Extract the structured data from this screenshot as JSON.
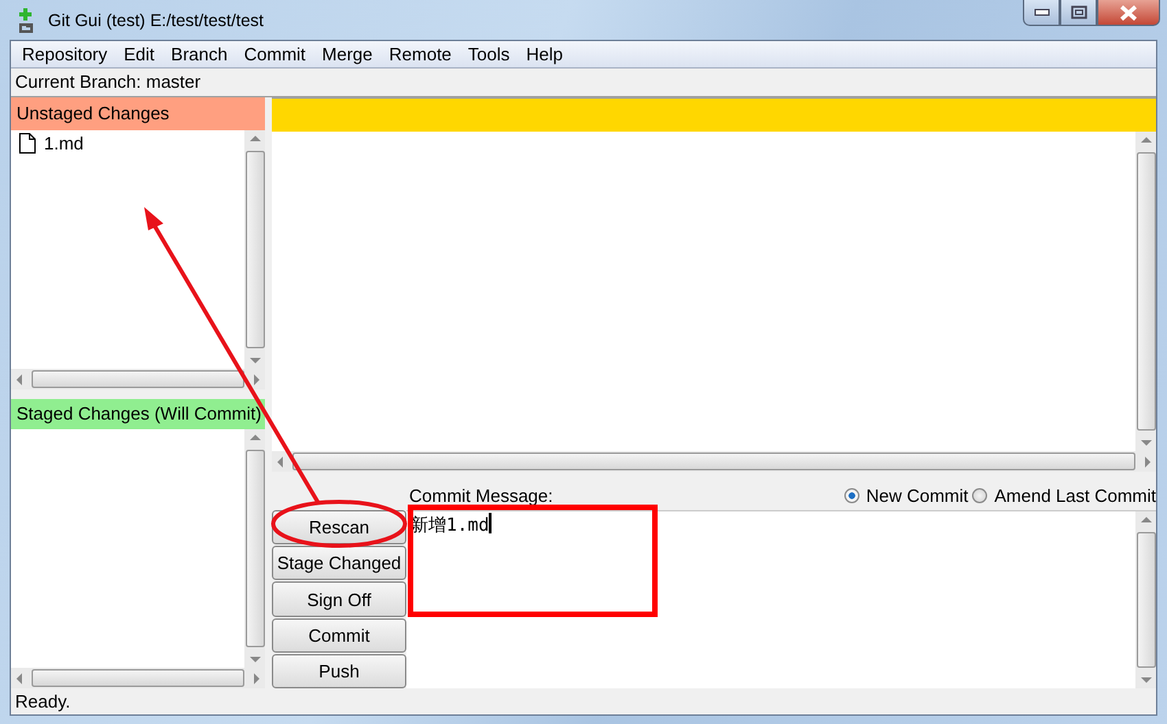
{
  "window": {
    "title": "Git Gui (test) E:/test/test/test"
  },
  "menu": [
    "Repository",
    "Edit",
    "Branch",
    "Commit",
    "Merge",
    "Remote",
    "Tools",
    "Help"
  ],
  "current_branch": "Current Branch: master",
  "unstaged": {
    "title": "Unstaged Changes",
    "files": [
      {
        "name": "1.md"
      }
    ]
  },
  "staged": {
    "title": "Staged Changes (Will Commit)"
  },
  "actions": [
    "Rescan",
    "Stage Changed",
    "Sign Off",
    "Commit",
    "Push"
  ],
  "commit_message": {
    "label": "Commit Message:",
    "value": "新增1.md"
  },
  "commit_modes": [
    {
      "label": "New Commit",
      "selected": true
    },
    {
      "label": "Amend Last Commit",
      "selected": false
    }
  ],
  "annotations": [
    {
      "kind": "arrow"
    },
    {
      "kind": "ellipse"
    },
    {
      "kind": "rectangle"
    }
  ],
  "status_bar": "Ready."
}
